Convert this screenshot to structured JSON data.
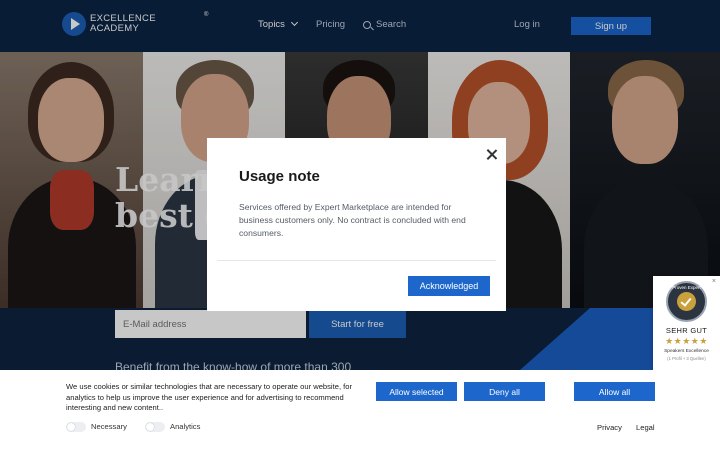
{
  "header": {
    "logo_line1": "EXCELLENCE",
    "logo_line2": "ACADEMY",
    "logo_reg": "®",
    "nav": {
      "topics": "Topics",
      "pricing": "Pricing",
      "search": "Search",
      "login": "Log in",
      "signup": "Sign up"
    }
  },
  "hero": {
    "title_line1": "Learn",
    "title_line2": "best e"
  },
  "signup_form": {
    "email_placeholder": "E-Mail address",
    "start_button": "Start for free",
    "benefit_text": "Benefit from the know-how of more than 300"
  },
  "modal": {
    "title": "Usage note",
    "body": "Services offered by Expert Marketplace are intended for business customers only. No contract is concluded with end consumers.",
    "acknowledge_button": "Acknowledged"
  },
  "badge": {
    "close": "×",
    "seal_text": "Proven Expert",
    "rating_text": "SEHR GUT",
    "stars": "★★★★★",
    "subtitle": "Speakers Excellence",
    "subtitle2": "(1 Profil + 3 Quellen)"
  },
  "cookie_bar": {
    "text": "We use cookies or similar technologies that are necessary to operate our website, for analytics to help us improve the user experience and for advertising to recommend interesting and new content..",
    "allow_selected": "Allow selected",
    "deny_all": "Deny all",
    "allow_all": "Allow all",
    "necessary_label": "Necessary",
    "analytics_label": "Analytics",
    "privacy_link": "Privacy",
    "legal_link": "Legal"
  },
  "colors": {
    "header_bg": "#0c2446",
    "accent_blue": "#1c66cc",
    "modal_bg": "#ffffff"
  }
}
